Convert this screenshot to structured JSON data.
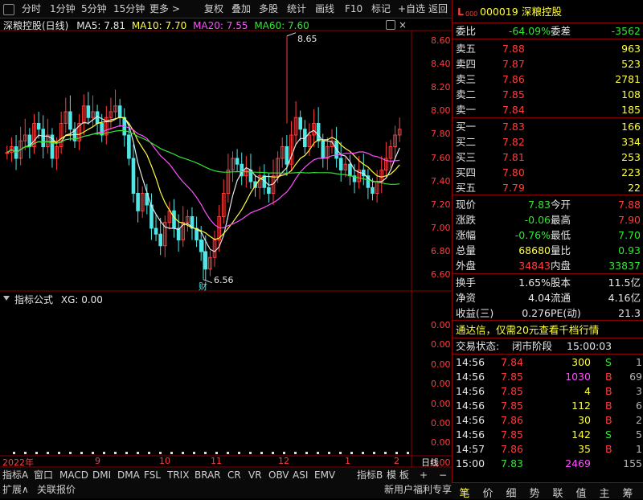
{
  "toolbar": {
    "items": [
      "分时",
      "1分钟",
      "5分钟",
      "15分钟",
      "更多 >",
      "复权",
      "叠加",
      "多股",
      "统计",
      "画线",
      "F10",
      "标记",
      "+自选",
      "返回"
    ]
  },
  "main_chart": {
    "title": "深粮控股(日线)",
    "ma_labels": [
      {
        "text": "MA5: 7.81",
        "color": "#e6e6e6"
      },
      {
        "text": "MA10: 7.70",
        "color": "#ffff3c"
      },
      {
        "text": "MA20: 7.55",
        "color": "#ff50ff"
      },
      {
        "text": "MA60: 7.60",
        "color": "#32e632"
      }
    ],
    "annotations": {
      "high": "8.65",
      "low": "6.56",
      "fin_mark": "财"
    },
    "y_ticks": [
      "8.60",
      "8.40",
      "8.20",
      "8.00",
      "7.80",
      "7.60",
      "7.40",
      "7.20",
      "7.00",
      "6.80",
      "6.60"
    ]
  },
  "indicator": {
    "title": "指标公式",
    "value_label": "XG: 0.00",
    "y_ticks": [
      "0.00",
      "0.00",
      "0.00",
      "0.00",
      "0.00",
      "0.00",
      "0.00",
      "0.00",
      "0.00"
    ]
  },
  "x_axis": {
    "labels": [
      "2022年",
      "9",
      "10",
      "11",
      "12",
      "1",
      "2"
    ],
    "period": "日线"
  },
  "bottom_tabs": {
    "row1": [
      "指标A",
      "窗口",
      "MACD",
      "DMI",
      "DMA",
      "FSL",
      "TRIX",
      "BRAR",
      "CR",
      "VR",
      "OBV",
      "ASI",
      "EMV",
      "指标B",
      "模 板",
      "+",
      "−"
    ],
    "row2": [
      "扩展∧",
      "关联报价",
      "新用户福利专享"
    ]
  },
  "stock": {
    "code": "000019",
    "name": "深粮控股",
    "badge": "L",
    "badge_sub": "000",
    "weibi_label": "委比",
    "weibi": "-64.09%",
    "weicha_label": "委差",
    "weicha": "-3562"
  },
  "asks": [
    {
      "label": "卖五",
      "price": "7.88",
      "vol": "963"
    },
    {
      "label": "卖四",
      "price": "7.87",
      "vol": "523"
    },
    {
      "label": "卖三",
      "price": "7.86",
      "vol": "2781"
    },
    {
      "label": "卖二",
      "price": "7.85",
      "vol": "108"
    },
    {
      "label": "卖一",
      "price": "7.84",
      "vol": "185"
    }
  ],
  "bids": [
    {
      "label": "买一",
      "price": "7.83",
      "vol": "166"
    },
    {
      "label": "买二",
      "price": "7.82",
      "vol": "334"
    },
    {
      "label": "买三",
      "price": "7.81",
      "vol": "253"
    },
    {
      "label": "买四",
      "price": "7.80",
      "vol": "223"
    },
    {
      "label": "买五",
      "price": "7.79",
      "vol": "22"
    }
  ],
  "quote": [
    {
      "l1": "现价",
      "v1": "7.83",
      "c1": "green",
      "l2": "今开",
      "v2": "7.88",
      "c2": "red"
    },
    {
      "l1": "涨跌",
      "v1": "-0.06",
      "c1": "green",
      "l2": "最高",
      "v2": "7.90",
      "c2": "red"
    },
    {
      "l1": "涨幅",
      "v1": "-0.76%",
      "c1": "green",
      "l2": "最低",
      "v2": "7.70",
      "c2": "green"
    },
    {
      "l1": "总量",
      "v1": "68680",
      "c1": "yellow",
      "l2": "量比",
      "v2": "0.93",
      "c2": "green"
    },
    {
      "l1": "外盘",
      "v1": "34843",
      "c1": "red",
      "l2": "内盘",
      "v2": "33837",
      "c2": "green"
    }
  ],
  "finance": [
    {
      "l1": "换手",
      "v1": "1.65%",
      "l2": "股本",
      "v2": "11.5亿"
    },
    {
      "l1": "净资",
      "v1": "4.04",
      "l2": "流通",
      "v2": "4.16亿"
    },
    {
      "l1": "收益(三)",
      "v1": "0.276",
      "l2": "PE(动)",
      "v2": "21.3"
    }
  ],
  "promo": "通达信，仅需20元查看千档行情",
  "trade_status": {
    "label": "交易状态:",
    "value": "闭市阶段",
    "time": "15:00:03"
  },
  "ticks": [
    {
      "time": "14:56",
      "price": "7.84",
      "pc": "red",
      "vol": "300",
      "vc": "yellow",
      "side": "S",
      "sc": "green",
      "n": "1"
    },
    {
      "time": "14:56",
      "price": "7.85",
      "pc": "red",
      "vol": "1030",
      "vc": "magenta",
      "side": "B",
      "sc": "red",
      "n": "69"
    },
    {
      "time": "14:56",
      "price": "7.85",
      "pc": "red",
      "vol": "4",
      "vc": "yellow",
      "side": "B",
      "sc": "red",
      "n": "3"
    },
    {
      "time": "14:56",
      "price": "7.85",
      "pc": "red",
      "vol": "112",
      "vc": "yellow",
      "side": "B",
      "sc": "red",
      "n": "6"
    },
    {
      "time": "14:56",
      "price": "7.86",
      "pc": "red",
      "vol": "30",
      "vc": "yellow",
      "side": "B",
      "sc": "red",
      "n": "2"
    },
    {
      "time": "14:56",
      "price": "7.85",
      "pc": "red",
      "vol": "142",
      "vc": "yellow",
      "side": "S",
      "sc": "green",
      "n": "5"
    },
    {
      "time": "14:57",
      "price": "7.86",
      "pc": "red",
      "vol": "35",
      "vc": "yellow",
      "side": "B",
      "sc": "red",
      "n": "1"
    },
    {
      "time": "15:00",
      "price": "7.83",
      "pc": "green",
      "vol": "2469",
      "vc": "magenta",
      "side": "",
      "sc": "white",
      "n": "155"
    }
  ],
  "rp_tabs": [
    "笔",
    "价",
    "细",
    "势",
    "联",
    "值",
    "主",
    "筹"
  ],
  "colors": {
    "up": "#ff3c3c",
    "down": "#50e6e6",
    "grid": "#8b0000",
    "ma5": "#e6e6e6",
    "ma10": "#ffff3c",
    "ma20": "#ff50ff",
    "ma60": "#32e632"
  }
}
